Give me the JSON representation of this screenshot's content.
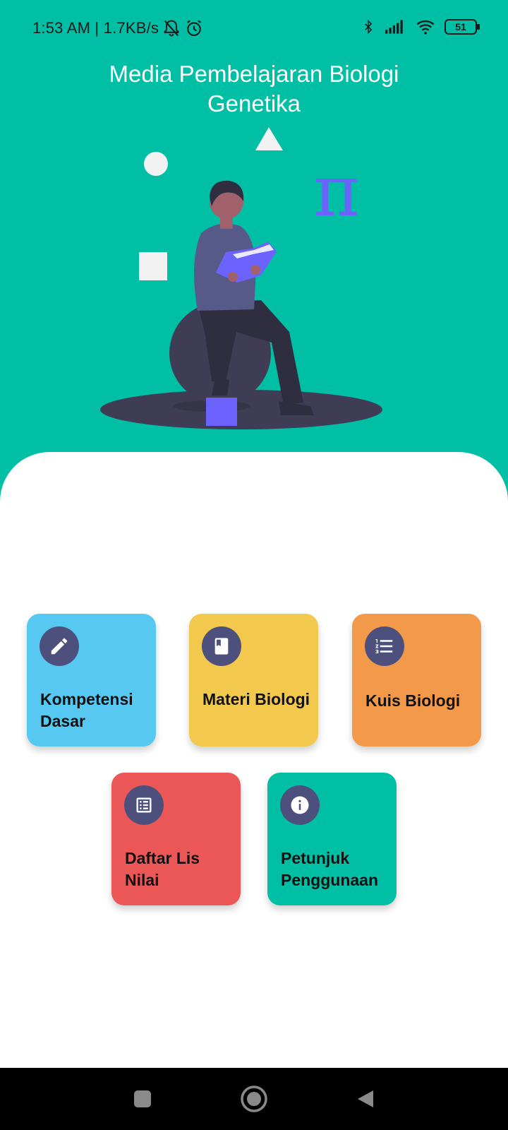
{
  "status_bar": {
    "time_speed": "1:53 AM | 1.7KB/s",
    "battery_level": "51",
    "icons": [
      "bell-off-icon",
      "alarm-icon",
      "bluetooth-icon",
      "signal-icon",
      "wifi-icon",
      "battery-icon"
    ]
  },
  "header": {
    "title_line1": "Media Pembelajaran Biologi",
    "title_line2": "Genetika",
    "background_color": "#00bfa5",
    "illustration": "person-reading-book-illustration"
  },
  "menu": {
    "items": [
      {
        "label": "Kompetensi Dasar",
        "color": "#56c8f1",
        "icon": "pencil-icon"
      },
      {
        "label": "Materi Biologi",
        "color": "#f2c94c",
        "icon": "book-icon"
      },
      {
        "label": "Kuis Biologi",
        "color": "#f2994a",
        "icon": "numbered-list-icon"
      },
      {
        "label": "Daftar Lis Nilai",
        "color": "#eb5757",
        "icon": "list-document-icon"
      },
      {
        "label": "Petunjuk Penggunaan",
        "color": "#00bfa5",
        "icon": "info-icon"
      }
    ],
    "icon_circle_color": "#4d4f7c"
  },
  "nav_bar": {
    "buttons": [
      "recent-apps-button",
      "home-button",
      "back-button"
    ]
  }
}
